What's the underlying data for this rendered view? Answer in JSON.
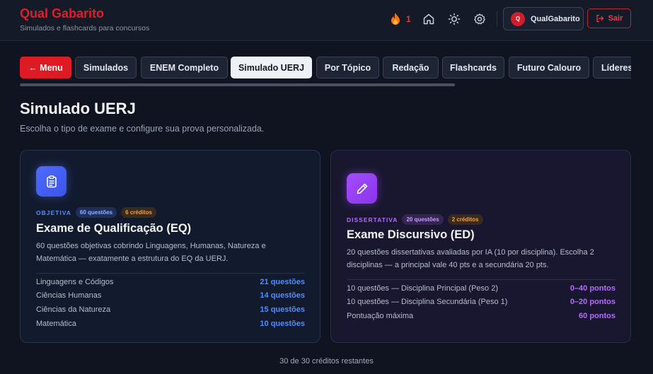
{
  "header": {
    "brand_title": "Qual Gabarito",
    "brand_subtitle": "Simulados e flashcards para concursos",
    "streak_count": "1",
    "user": {
      "avatar_letter": "Q",
      "name": "QualGabarito"
    },
    "logout_label": "Sair"
  },
  "tabs": [
    {
      "label": "← Menu"
    },
    {
      "label": "Simulados"
    },
    {
      "label": "ENEM Completo"
    },
    {
      "label": "Simulado UERJ"
    },
    {
      "label": "Por Tópico"
    },
    {
      "label": "Redação"
    },
    {
      "label": "Flashcards"
    },
    {
      "label": "Futuro Calouro"
    },
    {
      "label": "Líderes"
    }
  ],
  "page": {
    "title": "Simulado UERJ",
    "subtitle": "Escolha o tipo de exame e configure sua prova personalizada."
  },
  "cards": {
    "eq": {
      "type": "OBJETIVA",
      "questions_pill": "60 questões",
      "credits_pill": "6 créditos",
      "title": "Exame de Qualificação (EQ)",
      "description": "60 questões objetivas cobrindo Linguagens, Humanas, Natureza e Matemática — exatamente a estrutura do EQ da UERJ.",
      "rows": [
        {
          "label": "Linguagens e Códigos",
          "value": "21 questões"
        },
        {
          "label": "Ciências Humanas",
          "value": "14 questões"
        },
        {
          "label": "Ciências da Natureza",
          "value": "15 questões"
        },
        {
          "label": "Matemática",
          "value": "10 questões"
        }
      ]
    },
    "ed": {
      "type": "DISSERTATIVA",
      "questions_pill": "20 questões",
      "credits_pill": "2 créditos",
      "title": "Exame Discursivo (ED)",
      "description": "20 questões dissertativas avaliadas por IA (10 por disciplina). Escolha 2 disciplinas — a principal vale 40 pts e a secundária 20 pts.",
      "rows": [
        {
          "label": "10 questões — Disciplina Principal (Peso 2)",
          "value": "0–40 pontos"
        },
        {
          "label": "10 questões — Disciplina Secundária (Peso 1)",
          "value": "0–20 pontos"
        },
        {
          "label": "Pontuação máxima",
          "value": "60 pontos"
        }
      ]
    }
  },
  "footer": {
    "credits_remaining": "30 de 30 créditos restantes"
  },
  "colors": {
    "brand_red": "#e11d2a",
    "accent_blue": "#4f8dff",
    "accent_purple": "#b56bff",
    "credits_orange": "#f0a040"
  }
}
